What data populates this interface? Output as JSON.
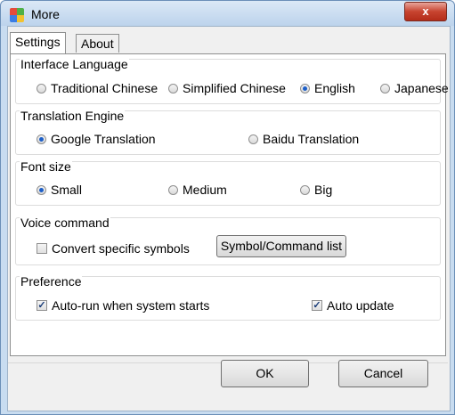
{
  "window": {
    "title": "More",
    "close_label": "x"
  },
  "tabs": [
    {
      "label": "Settings"
    },
    {
      "label": "About"
    }
  ],
  "interface_language": {
    "title": "Interface Language",
    "options": [
      "Traditional Chinese",
      "Simplified Chinese",
      "English",
      "Japanese"
    ],
    "selected": "English"
  },
  "translation_engine": {
    "title": "Translation Engine",
    "options": [
      "Google Translation",
      "Baidu Translation"
    ],
    "selected": "Google Translation"
  },
  "font_size": {
    "title": "Font size",
    "options": [
      "Small",
      "Medium",
      "Big"
    ],
    "selected": "Small"
  },
  "voice_command": {
    "title": "Voice command",
    "convert_label": "Convert specific symbols",
    "convert_checked": false,
    "list_button": "Symbol/Command list"
  },
  "preference": {
    "title": "Preference",
    "autorun_label": "Auto-run when system starts",
    "autorun_checked": true,
    "autoupdate_label": "Auto update",
    "autoupdate_checked": true
  },
  "buttons": {
    "ok": "OK",
    "cancel": "Cancel"
  },
  "colors": {
    "radio_dot": "#1d5fc8",
    "close_button": "#c7432f",
    "titlebar": "#c8dcf0"
  }
}
